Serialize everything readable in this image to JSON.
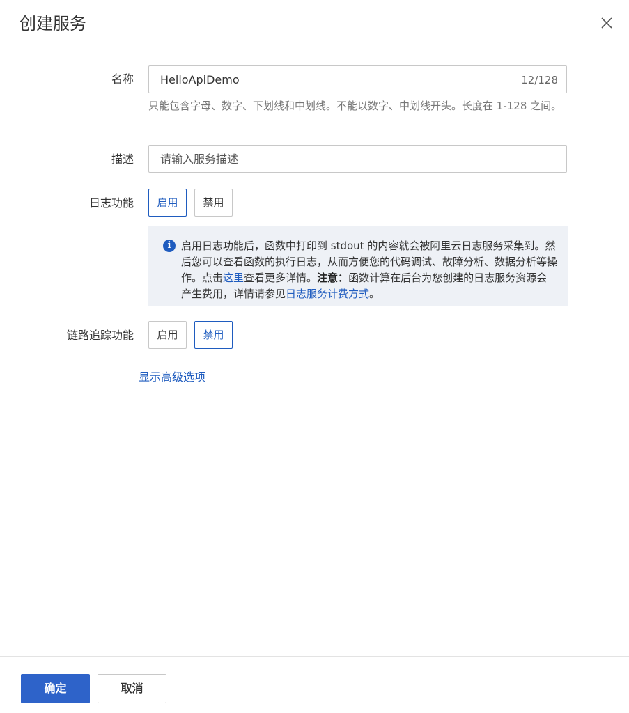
{
  "dialog": {
    "title": "创建服务",
    "close_icon": "close-icon"
  },
  "form": {
    "name": {
      "label": "名称",
      "value": "HelloApiDemo",
      "counter": "12/128",
      "hint": "只能包含字母、数字、下划线和中划线。不能以数字、中划线开头。长度在 1-128 之间。"
    },
    "description": {
      "label": "描述",
      "placeholder": "请输入服务描述"
    },
    "log": {
      "label": "日志功能",
      "options": [
        "启用",
        "禁用"
      ],
      "selected": "启用"
    },
    "log_info": {
      "icon": "info-icon",
      "text_1": "启用日志功能后，函数中打印到 stdout 的内容就会被阿里云日志服务采集到。然后您可以查看函数的执行日志，从而方便您的代码调试、故障分析、数据分析等操作。点击",
      "link_here": "这里",
      "text_2": "查看更多详情。",
      "notice_label": "注意：",
      "text_3": "函数计算在后台为您创建的日志服务资源会产生费用，详情请参见",
      "link_billing": "日志服务计费方式",
      "text_4": "。"
    },
    "tracing": {
      "label": "链路追踪功能",
      "options": [
        "启用",
        "禁用"
      ],
      "selected": "禁用"
    },
    "advanced_link": "显示高级选项"
  },
  "footer": {
    "confirm": "确定",
    "cancel": "取消"
  },
  "colors": {
    "primary": "#2e63c9",
    "link": "#1f5cbf",
    "info_bg": "#eef1f6"
  }
}
